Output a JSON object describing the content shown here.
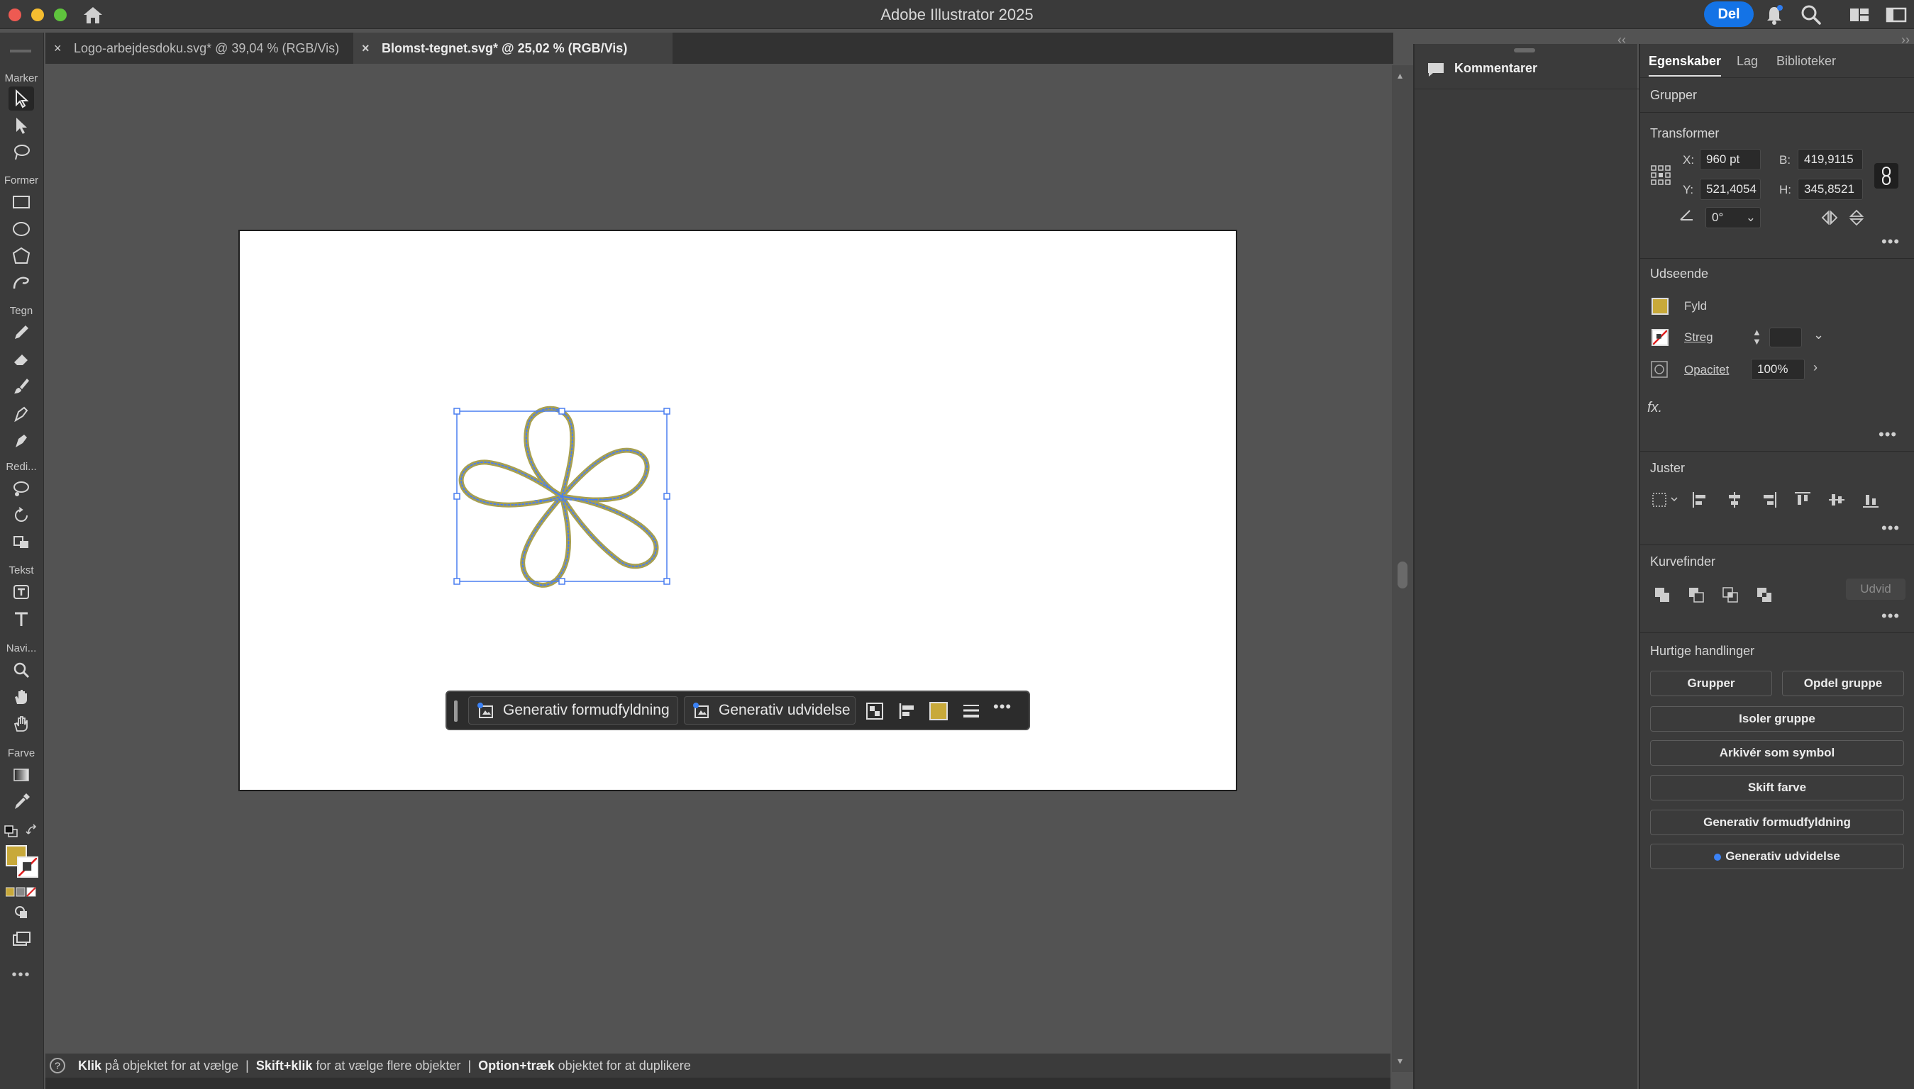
{
  "titlebar": {
    "title": "Adobe Illustrator 2025",
    "share_label": "Del",
    "icons": [
      "home-icon",
      "bell-icon",
      "search-icon",
      "workspace-icon",
      "panel-toggle-icon"
    ]
  },
  "tabs": [
    {
      "label": "Logo-arbejdesdoku.svg* @ 39,04 % (RGB/Vis)",
      "close": "×",
      "active": false
    },
    {
      "label": "Blomst-tegnet.svg* @ 25,02 % (RGB/Vis)",
      "close": "×",
      "active": true
    }
  ],
  "toolbar": {
    "sections": [
      "Marker",
      "Former",
      "Tegn",
      "Redi...",
      "Tekst",
      "Navi...",
      "Farve"
    ],
    "more": "•••",
    "fill_color": "#c8a93a"
  },
  "context_bar": {
    "gen_fill_label": "Generativ formudfyldning",
    "gen_expand_label": "Generativ udvidelse",
    "more": "•••",
    "swatch_color": "#c8a93a"
  },
  "statusbar": {
    "help": "?",
    "part1_bold": "Klik",
    "part1": " på objektet for at vælge  |  ",
    "part2_bold": "Skift+klik",
    "part2": " for at vælge flere objekter  |  ",
    "part3_bold": "Option+træk",
    "part3": " objektet for at duplikere"
  },
  "comments": {
    "title": "Kommentarer"
  },
  "properties": {
    "tabs": [
      "Egenskaber",
      "Lag",
      "Biblioteker"
    ],
    "object_type": "Grupper",
    "transform": {
      "title": "Transformer",
      "x_label": "X:",
      "x": "960 pt",
      "y_label": "Y:",
      "y": "521,4054",
      "w_label": "B:",
      "w": "419,9115",
      "h_label": "H:",
      "h": "345,8521",
      "angle": "0°"
    },
    "appearance": {
      "title": "Udseende",
      "fill_label": "Fyld",
      "stroke_label": "Streg",
      "opacity_label": "Opacitet",
      "opacity": "100%",
      "fx": "fx."
    },
    "align": {
      "title": "Juster"
    },
    "pathfinder": {
      "title": "Kurvefinder",
      "expand_label": "Udvid"
    },
    "quick_actions": {
      "title": "Hurtige handlinger",
      "group": "Grupper",
      "ungroup": "Opdel gruppe",
      "isolate": "Isoler gruppe",
      "archive_symbol": "Arkivér som symbol",
      "recolor": "Skift farve",
      "gen_fill": "Generativ formudfyldning",
      "gen_expand": "Generativ udvidelse"
    },
    "more": "•••"
  },
  "colors": {
    "accent": "#1473e6",
    "selection": "#4a7ef0",
    "flower_stroke": "#a8a050"
  }
}
